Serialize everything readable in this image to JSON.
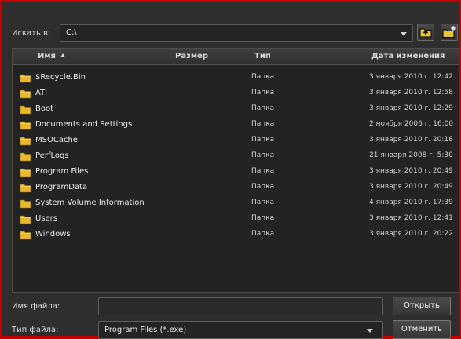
{
  "lookin": {
    "label": "Искать в:",
    "path": "C:\\"
  },
  "columns": {
    "name": "Имя",
    "size": "Размер",
    "type": "Тип",
    "modified": "Дата изменения"
  },
  "files": [
    {
      "name": "$Recycle.Bin",
      "type": "Папка",
      "modified": "3 января 2010 г. 12:42"
    },
    {
      "name": "ATI",
      "type": "Папка",
      "modified": "3 января 2010 г. 12:58"
    },
    {
      "name": "Boot",
      "type": "Папка",
      "modified": "3 января 2010 г. 12:29"
    },
    {
      "name": "Documents and Settings",
      "type": "Папка",
      "modified": "2 ноября 2006 г. 16:00"
    },
    {
      "name": "MSOCache",
      "type": "Папка",
      "modified": "3 января 2010 г. 20:18"
    },
    {
      "name": "PerfLogs",
      "type": "Папка",
      "modified": "21 января 2008 г. 5:30"
    },
    {
      "name": "Program Files",
      "type": "Папка",
      "modified": "3 января 2010 г. 20:49"
    },
    {
      "name": "ProgramData",
      "type": "Папка",
      "modified": "3 января 2010 г. 20:49"
    },
    {
      "name": "System Volume Information",
      "type": "Папка",
      "modified": "4 января 2010 г. 17:39"
    },
    {
      "name": "Users",
      "type": "Папка",
      "modified": "3 января 2010 г. 12:41"
    },
    {
      "name": "Windows",
      "type": "Папка",
      "modified": "3 января 2010 г. 20:22"
    }
  ],
  "filename": {
    "label": "Имя файла:",
    "value": ""
  },
  "filetype": {
    "label": "Тип файла:",
    "value": "Program Files (*.exe)"
  },
  "buttons": {
    "open": "Открыть",
    "cancel": "Отменить"
  },
  "icons": {
    "up": "folder-up-icon",
    "new_folder": "new-folder-icon",
    "folder": "folder-icon"
  },
  "colors": {
    "background": "#2e2e2e",
    "frame": "#c40000",
    "folder": "#e8b830"
  }
}
